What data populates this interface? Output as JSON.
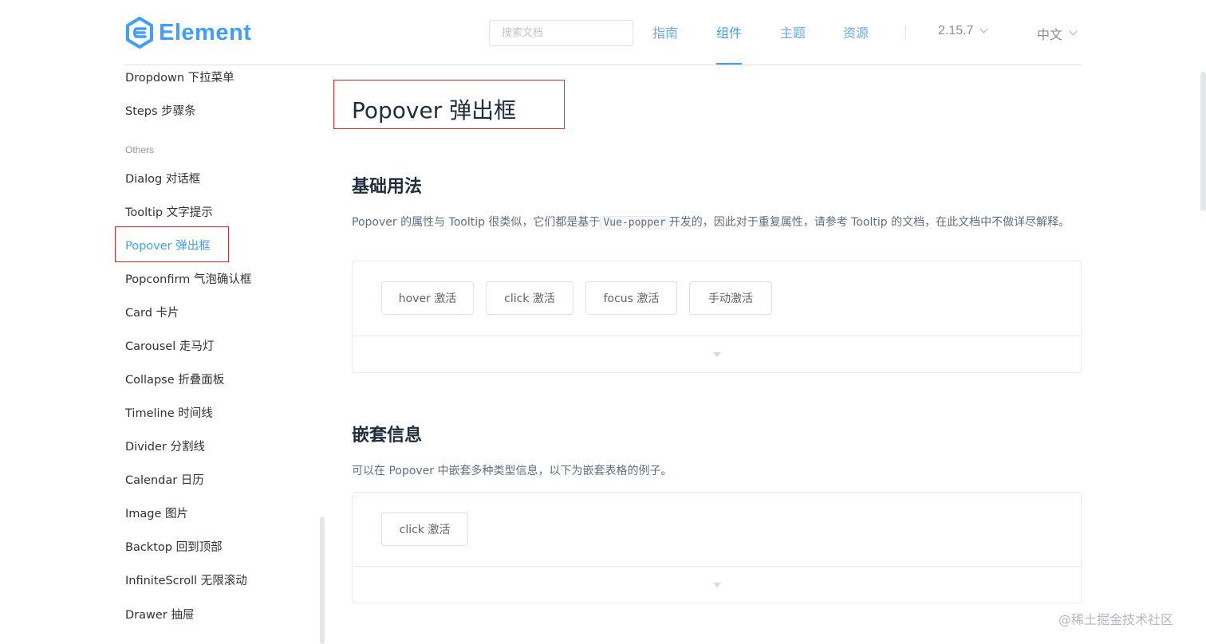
{
  "header": {
    "logo_text": "Element",
    "search_placeholder": "搜索文档",
    "nav": [
      "指南",
      "组件",
      "主题",
      "资源"
    ],
    "version": "2.15.7",
    "language": "中文",
    "accent_color": "#409eff"
  },
  "sidebar": {
    "items_top": [
      "Dropdown 下拉菜单",
      "Steps 步骤条"
    ],
    "group_label": "Others",
    "items": [
      "Dialog 对话框",
      "Tooltip 文字提示",
      "Popover 弹出框",
      "Popconfirm 气泡确认框",
      "Card 卡片",
      "Carousel 走马灯",
      "Collapse 折叠面板",
      "Timeline 时间线",
      "Divider 分割线",
      "Calendar 日历",
      "Image 图片",
      "Backtop 回到顶部",
      "InfiniteScroll 无限滚动",
      "Drawer 抽屉"
    ],
    "active_item": "Popover 弹出框"
  },
  "main": {
    "title": "Popover 弹出框",
    "sections": [
      {
        "heading": "基础用法",
        "text_before_code": "Popover 的属性与 Tooltip 很类似，它们都是基于",
        "code": "Vue-popper",
        "text_after_code": "开发的，因此对于重复属性，请参考 Tooltip 的文档，在此文档中不做详尽解释。",
        "buttons": [
          "hover 激活",
          "click 激活",
          "focus 激活",
          "手动激活"
        ]
      },
      {
        "heading": "嵌套信息",
        "text": "可以在 Popover 中嵌套多种类型信息，以下为嵌套表格的例子。",
        "buttons": [
          "click 激活"
        ]
      }
    ]
  },
  "watermark": "@稀土掘金技术社区"
}
